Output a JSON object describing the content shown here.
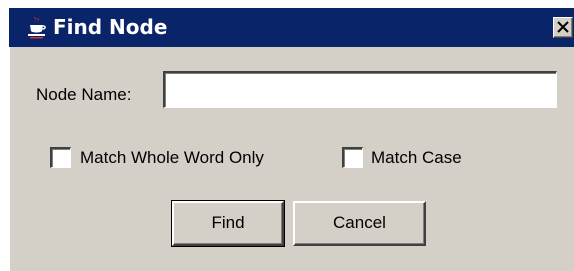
{
  "window": {
    "title": "Find Node",
    "app_icon": "java-cup-icon",
    "close_icon": "close-icon"
  },
  "form": {
    "node_name_label": "Node Name:",
    "node_name_value": "",
    "node_name_placeholder": ""
  },
  "options": {
    "match_whole_word": {
      "label": "Match Whole Word Only",
      "checked": false
    },
    "match_case": {
      "label": "Match Case",
      "checked": false
    }
  },
  "buttons": {
    "find_label": "Find",
    "cancel_label": "Cancel"
  },
  "colors": {
    "titlebar": "#0a246a",
    "dialog_face": "#d4d0c8",
    "title_text": "#ffffff"
  }
}
